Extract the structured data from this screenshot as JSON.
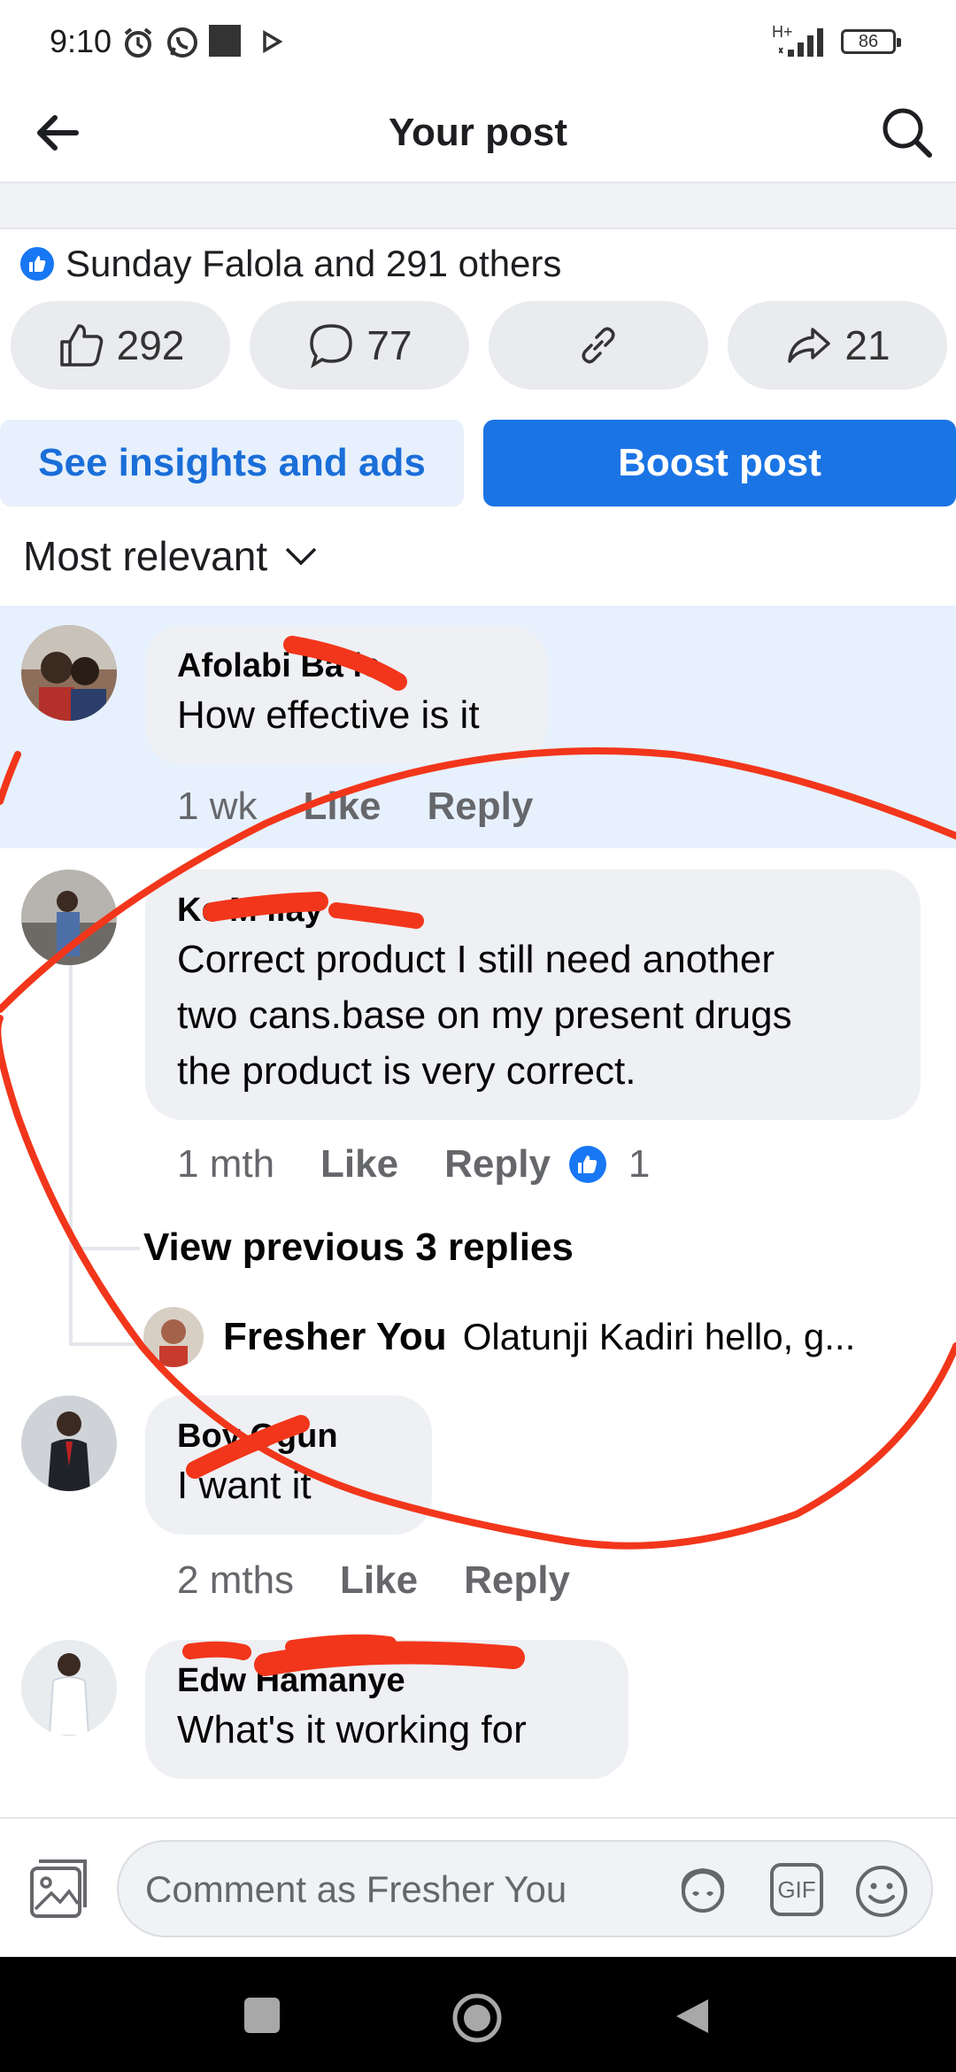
{
  "status_bar": {
    "time": "9:10",
    "network": "H+",
    "battery": "86"
  },
  "header": {
    "title": "Your post"
  },
  "reactions": {
    "summary": "Sunday Falola and 291 others",
    "like_count": "292",
    "comment_count": "77",
    "share_count": "21"
  },
  "buttons": {
    "insights": "See insights and ads",
    "boost": "Boost post"
  },
  "sort": {
    "label": "Most relevant"
  },
  "comments": [
    {
      "name": "Afolabi Ba   le",
      "text": "How effective is it",
      "time": "1 wk",
      "like": "Like",
      "reply": "Reply"
    },
    {
      "name": "Ke      M    ilay",
      "text_lines": [
        "Correct product  I  still need another",
        "two cans.base on my  present   drugs",
        "the  product is very correct."
      ],
      "time": "1 mth",
      "like": "Like",
      "reply": "Reply",
      "reactions": "1"
    },
    {
      "name": "Boy    Ogun",
      "text": "I want it",
      "time": "2 mths",
      "like": "Like",
      "reply": "Reply"
    },
    {
      "name": "Edw          Hamanye",
      "text": "What's it working for"
    }
  ],
  "replies": {
    "view_previous": "View previous 3 replies",
    "preview_name": "Fresher You",
    "preview_text": "Olatunji Kadiri hello, g..."
  },
  "composer": {
    "placeholder": "Comment as Fresher You",
    "gif_label": "GIF"
  },
  "colors": {
    "accent": "#1b74e4",
    "highlight": "#e7f0fd",
    "scribble": "#f2361b"
  }
}
